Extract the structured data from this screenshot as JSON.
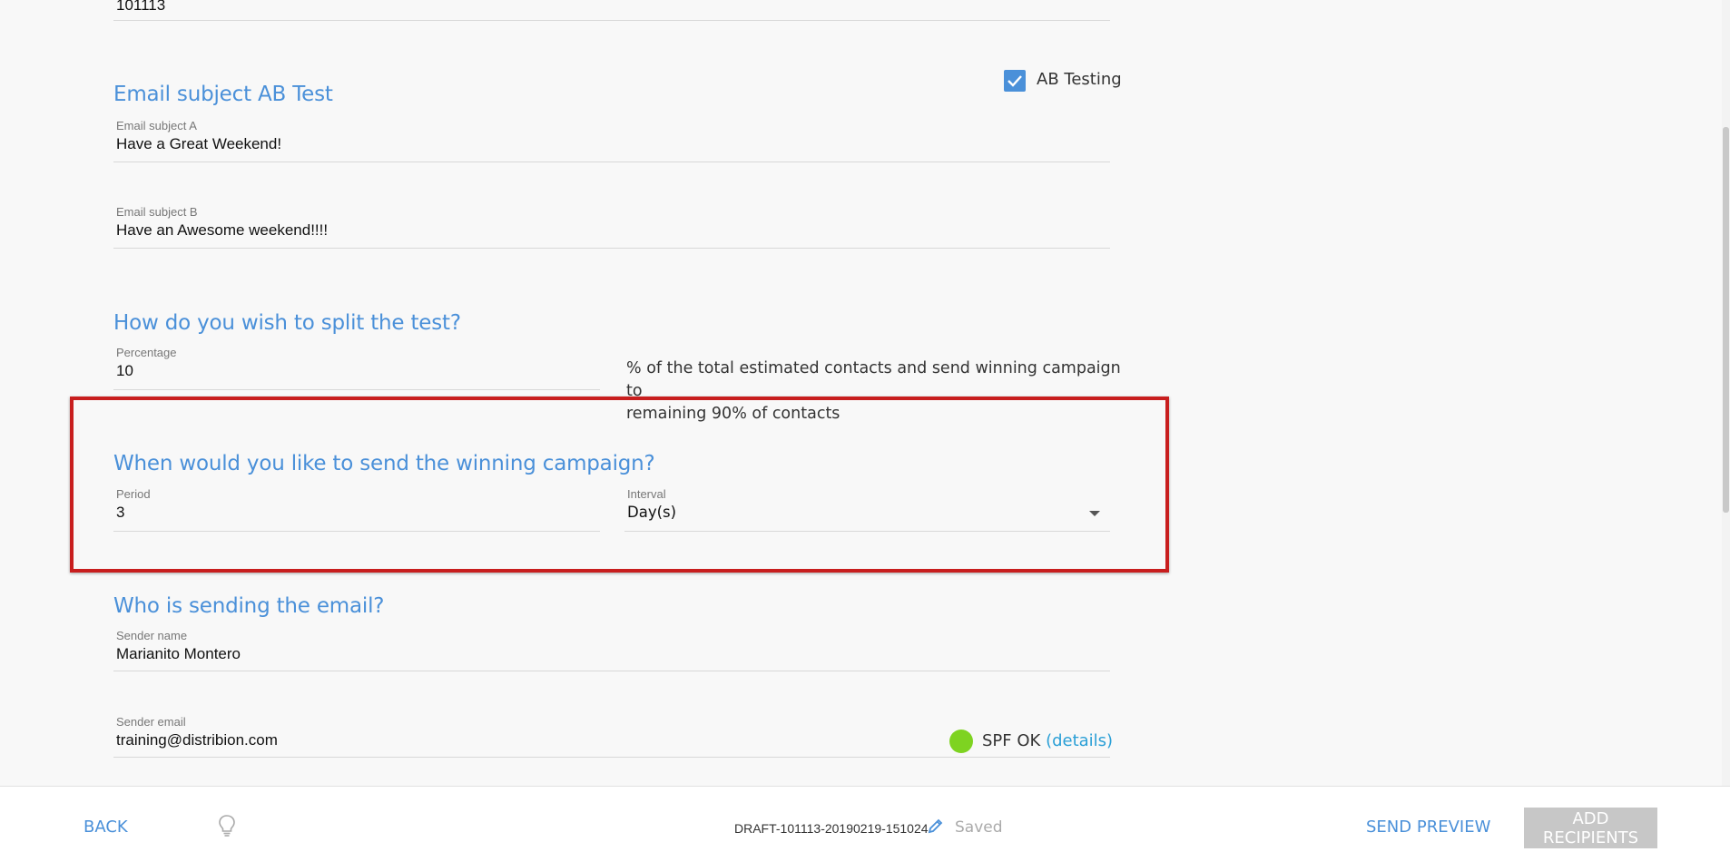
{
  "top_field": {
    "value": "101113"
  },
  "subject_section": {
    "title": "Email subject AB Test",
    "ab_testing_label": "AB Testing",
    "ab_testing_checked": true,
    "subject_a": {
      "label": "Email subject A",
      "value": "Have a Great Weekend!"
    },
    "subject_b": {
      "label": "Email subject B",
      "value": "Have an Awesome weekend!!!!"
    }
  },
  "split_section": {
    "title": "How do you wish to split the test?",
    "percentage": {
      "label": "Percentage",
      "value": "10"
    },
    "description_line1": "% of the total estimated contacts and send winning campaign to",
    "description_line2": "remaining 90% of contacts"
  },
  "winning_section": {
    "title": "When would you like to send the winning campaign?",
    "period": {
      "label": "Period",
      "value": "3"
    },
    "interval": {
      "label": "Interval",
      "value": "Day(s)"
    },
    "highlight_color": "#c81e1e"
  },
  "sender_section": {
    "title": "Who is sending the email?",
    "sender_name": {
      "label": "Sender name",
      "value": "Marianito Montero"
    },
    "sender_email": {
      "label": "Sender email",
      "value": "training@distribion.com"
    },
    "spf_status": "SPF OK",
    "spf_link": "(details)",
    "spf_color": "#7ed321"
  },
  "footer": {
    "back_label": "BACK",
    "bulb_icon": "lightbulb-icon",
    "draft_name": "DRAFT-101113-20190219-151024",
    "edit_icon": "pencil-icon",
    "saved_label": "Saved",
    "send_preview_label": "SEND PREVIEW",
    "add_recipients_label": "ADD RECIPIENTS"
  },
  "colors": {
    "accent": "#4a90d9",
    "background": "#f8f8f8"
  }
}
